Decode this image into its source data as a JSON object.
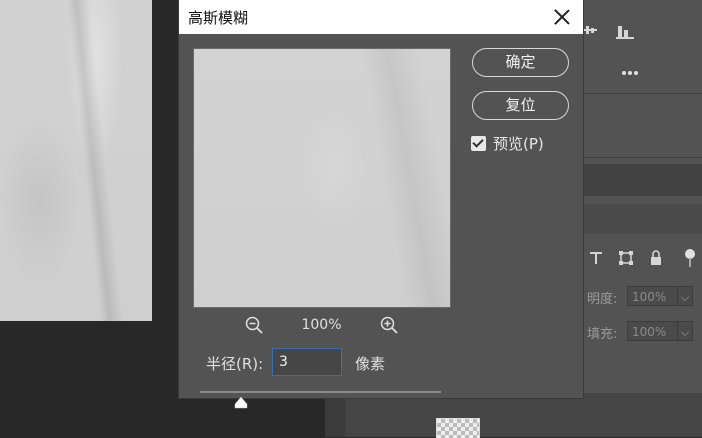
{
  "dialog": {
    "title": "高斯模糊",
    "ok_label": "确定",
    "reset_label": "复位",
    "preview_label": "预览(P)",
    "preview_checked": true,
    "zoom_level": "100%",
    "radius_label": "半径(R):",
    "radius_value": "3",
    "unit_label": "像素",
    "slider_fraction": 0.17
  },
  "right_panel": {
    "opacity_label": "明度:",
    "opacity_value": "100%",
    "fill_label": "填充:",
    "fill_value": "100%",
    "icons": [
      "align-icon",
      "histogram-icon",
      "more-icon",
      "type-layer-icon",
      "transform-icon",
      "lock-icon"
    ]
  },
  "colors": {
    "accent_input_border": "#3c6ea8",
    "dialog_bg": "#535353",
    "workspace_bg": "#282828"
  }
}
